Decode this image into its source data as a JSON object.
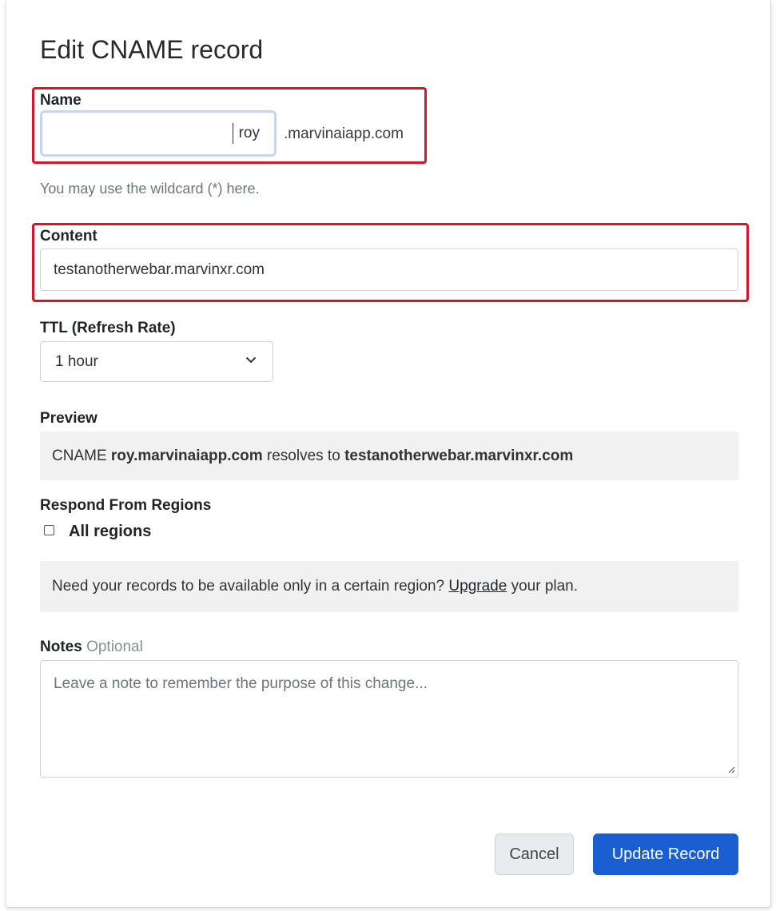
{
  "dialog": {
    "title": "Edit CNAME record",
    "name": {
      "label": "Name",
      "value": "roy",
      "suffix": ".marvinaiapp.com",
      "help": "You may use the wildcard (*) here."
    },
    "content": {
      "label": "Content",
      "value": "testanotherwebar.marvinxr.com"
    },
    "ttl": {
      "label": "TTL (Refresh Rate)",
      "selected": "1 hour"
    },
    "preview": {
      "label": "Preview",
      "type": "CNAME",
      "host": "roy.marvinaiapp.com",
      "verb": "resolves to",
      "target": "testanotherwebar.marvinxr.com"
    },
    "regions": {
      "label": "Respond From Regions",
      "checkbox_label": "All regions",
      "checked": false,
      "upsell_prefix": "Need your records to be available only in a certain region?",
      "upsell_link": "Upgrade",
      "upsell_suffix": "your plan."
    },
    "notes": {
      "label": "Notes",
      "optional": "Optional",
      "placeholder": "Leave a note to remember the purpose of this change..."
    },
    "buttons": {
      "cancel": "Cancel",
      "update": "Update Record"
    }
  },
  "colors": {
    "highlight": "#d3162a",
    "primary": "#1a5fd2",
    "panel_bg": "#f1f1f1"
  }
}
